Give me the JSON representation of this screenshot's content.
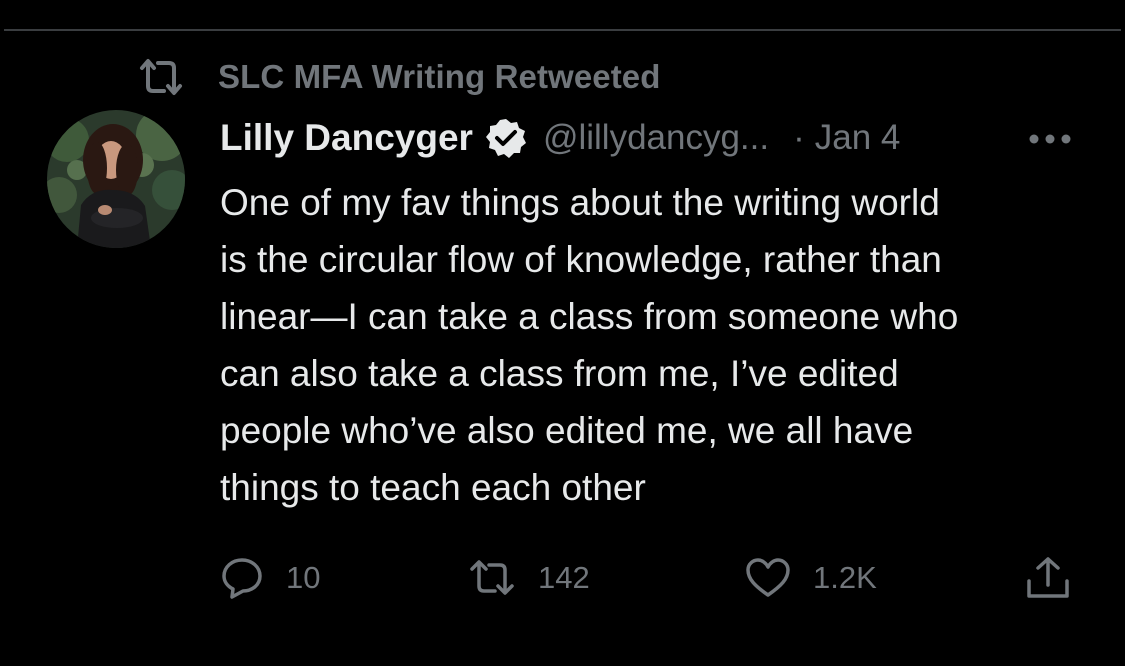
{
  "retweet_context": {
    "label": "SLC MFA Writing Retweeted",
    "icon": "retweet-icon"
  },
  "tweet": {
    "author": {
      "display_name": "Lilly Dancyger",
      "verified": true,
      "handle": "@lillydancyg...",
      "avatar": "profile-photo"
    },
    "separator": "·",
    "date": "Jan 4",
    "text_lines": [
      "One of my fav things about the writing world",
      "is the circular flow of knowledge, rather than",
      "linear—I can take a class from someone who",
      "can also take a class from me, I’ve edited",
      "people who’ve also edited me, we all have",
      "things to teach each other"
    ],
    "actions": {
      "reply": {
        "count": "10",
        "icon": "reply-icon"
      },
      "retweet": {
        "count": "142",
        "icon": "retweet-icon"
      },
      "like": {
        "count": "1.2K",
        "icon": "heart-icon"
      },
      "share": {
        "icon": "share-icon"
      }
    }
  },
  "colors": {
    "background": "#000000",
    "primary_text": "#e7e9ea",
    "secondary_text": "#71767b",
    "divider": "#3a3d40",
    "verified_badge": "#e7e9ea"
  }
}
